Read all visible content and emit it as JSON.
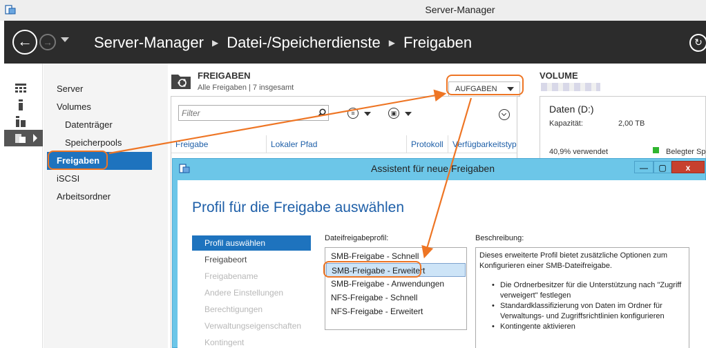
{
  "window": {
    "title": "Server-Manager"
  },
  "header": {
    "back_icon": "arrow-left",
    "forward_icon": "arrow-right",
    "breadcrumb": [
      "Server-Manager",
      "Datei-/Speicherdienste",
      "Freigaben"
    ],
    "refresh_icon": "refresh"
  },
  "nav": {
    "items": [
      {
        "label": "Server"
      },
      {
        "label": "Volumes"
      },
      {
        "label": "Datenträger"
      },
      {
        "label": "Speicherpools"
      },
      {
        "label": "Freigaben"
      },
      {
        "label": "iSCSI"
      },
      {
        "label": "Arbeitsordner"
      }
    ],
    "active": "Freigaben"
  },
  "shares": {
    "title": "FREIGABEN",
    "subtitle": "Alle Freigaben | 7 insgesamt",
    "tasks_label": "AUFGABEN",
    "filter_placeholder": "Filter",
    "columns": [
      "Freigabe",
      "Lokaler Pfad",
      "Protokoll",
      "Verfügbarkeitstyp"
    ]
  },
  "volume": {
    "title": "VOLUME",
    "name": "Daten (D:)",
    "capacity_label": "Kapazität:",
    "capacity_value": "2,00 TB",
    "used_text": "40,9% verwendet",
    "legend_used": "Belegter Sp",
    "used_color": "#2fb52f"
  },
  "wizard": {
    "title": "Assistent für neue Freigaben",
    "minimize_icon": "—",
    "maximize_icon": "▢",
    "close_icon": "x",
    "heading": "Profil für die Freigabe auswählen",
    "steps": [
      {
        "label": "Profil auswählen",
        "state": "active"
      },
      {
        "label": "Freigabeort",
        "state": "enabled"
      },
      {
        "label": "Freigabename",
        "state": "disabled"
      },
      {
        "label": "Andere Einstellungen",
        "state": "disabled"
      },
      {
        "label": "Berechtigungen",
        "state": "disabled"
      },
      {
        "label": "Verwaltungseigenschaften",
        "state": "disabled"
      },
      {
        "label": "Kontingent",
        "state": "disabled"
      }
    ],
    "profile_label": "Dateifreigabeprofil:",
    "profiles": [
      "SMB-Freigabe - Schnell",
      "SMB-Freigabe - Erweitert",
      "SMB-Freigabe - Anwendungen",
      "NFS-Freigabe - Schnell",
      "NFS-Freigabe - Erweitert"
    ],
    "selected_profile": "SMB-Freigabe - Erweitert",
    "description_label": "Beschreibung:",
    "description_intro": "Dieses erweiterte Profil bietet zusätzliche Optionen zum Konfigurieren einer SMB-Dateifreigabe.",
    "description_bullets": [
      "Die Ordnerbesitzer für die Unterstützung nach \"Zugriff verweigert\" festlegen",
      "Standardklassifizierung von Daten im Ordner für Verwaltungs- und Zugriffsrichtlinien konfigurieren",
      "Kontingente aktivieren"
    ]
  },
  "annotation_color": "#ee7524"
}
